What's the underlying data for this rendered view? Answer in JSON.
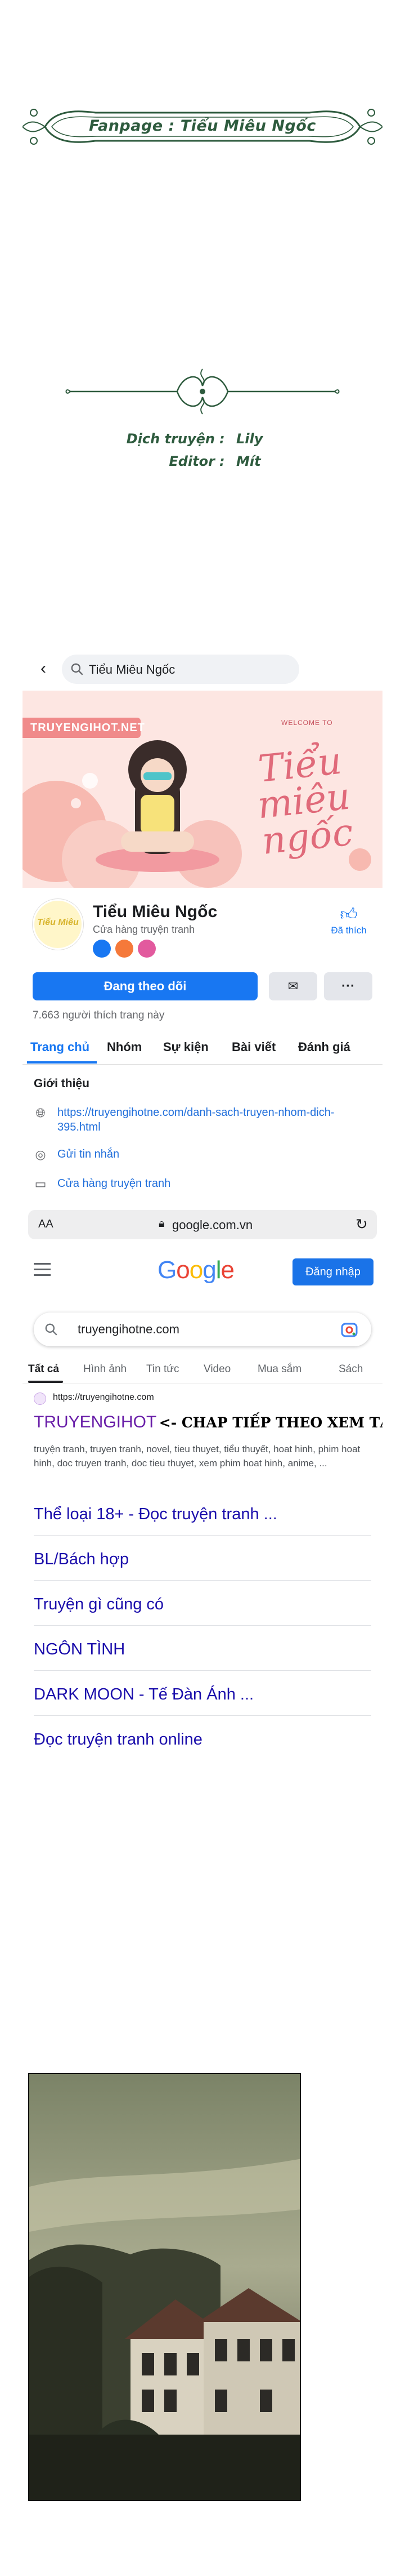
{
  "credits": {
    "fanpage": "Fanpage : Tiểu Miêu Ngốc",
    "lines": [
      {
        "label": "Dịch truyện",
        "sep": ":",
        "value": "Lily"
      },
      {
        "label": "Editor",
        "sep": ":",
        "value": "Mít"
      }
    ]
  },
  "facebook": {
    "back_icon": "back-arrow-icon",
    "search_query": "Tiểu Miêu Ngốc",
    "cover": {
      "tag": "TRUYENGIHOT.NET",
      "welcome": "WELCOME TO",
      "title": "Tiểu miêu ngốc"
    },
    "avatar_text": "Tiểu Miêu",
    "page_name": "Tiểu Miêu Ngốc",
    "category": "Cửa hàng truyện tranh",
    "like_label": "Đã thích",
    "follow_label": "Đang theo dõi",
    "more_label": "···",
    "likes_count": "7.663 người thích trang này",
    "tabs": [
      "Trang chủ",
      "Nhóm",
      "Sự kiện",
      "Bài viết",
      "Đánh giá"
    ],
    "intro": {
      "title": "Giới thiệu",
      "link": "https://truyengihotne.com/danh-sach-truyen-nhom-dich-395.html",
      "message": "Gửi tin nhắn",
      "category": "Cửa hàng truyện tranh"
    }
  },
  "safari": {
    "aa": "AA",
    "host": "google.com.vn"
  },
  "google": {
    "logo": "Google",
    "login_label": "Đăng nhập",
    "query": "truyengihotne.com",
    "tabs": [
      "Tất cả",
      "Hình ảnh",
      "Tin tức",
      "Video",
      "Mua sắm",
      "Sách"
    ],
    "result": {
      "url": "https://truyengihotne.com",
      "brand": "TRUYENGIHOT",
      "extra": "<- CHAP TIẾP THEO XEM TẠI ĐÂY NHA",
      "snippet": "truyện tranh, truyen tranh, novel, tieu thuyet, tiểu thuyết, hoat hinh, phim hoat hinh, doc truyen tranh, doc tieu thuyet, xem phim hoat hinh, anime, ..."
    },
    "sitelinks": [
      "Thể loại 18+ - Đọc truyện tranh ...",
      "BL/Bách hợp",
      "Truyện gì cũng có",
      "NGÔN TÌNH",
      "DARK MOON - Tế Đàn Ánh ...",
      "Đọc truyện tranh online"
    ]
  },
  "colors": {
    "facebook_blue": "#1877f2",
    "google_blue": "#1a73e8",
    "link_blue": "#1a0dab",
    "credit_green": "#2e5b3e"
  }
}
